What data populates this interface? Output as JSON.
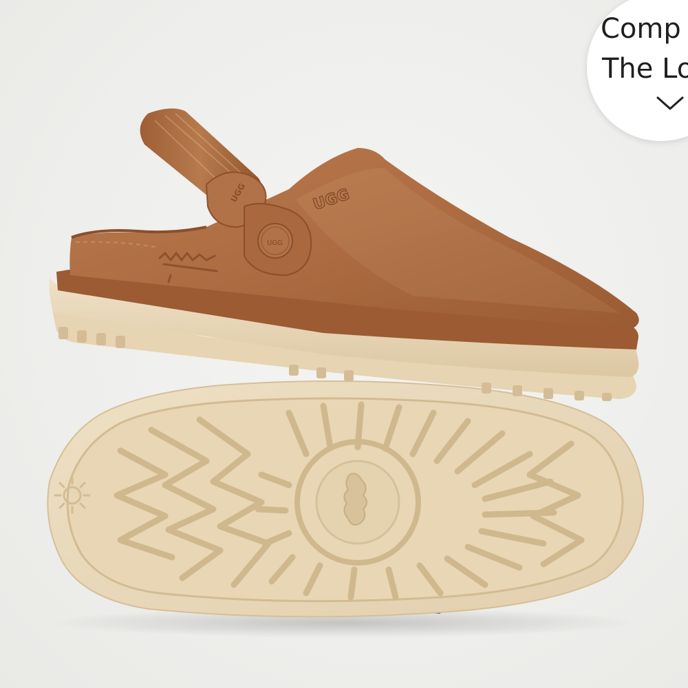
{
  "badge": {
    "line1": "Comp",
    "line2": "The Lo",
    "icon": "chevron-down-icon"
  },
  "product": {
    "brand_logo": "UGG"
  },
  "colors": {
    "suede": "#a8673c",
    "sole": "#e9d9bb",
    "background": "#efefed"
  }
}
